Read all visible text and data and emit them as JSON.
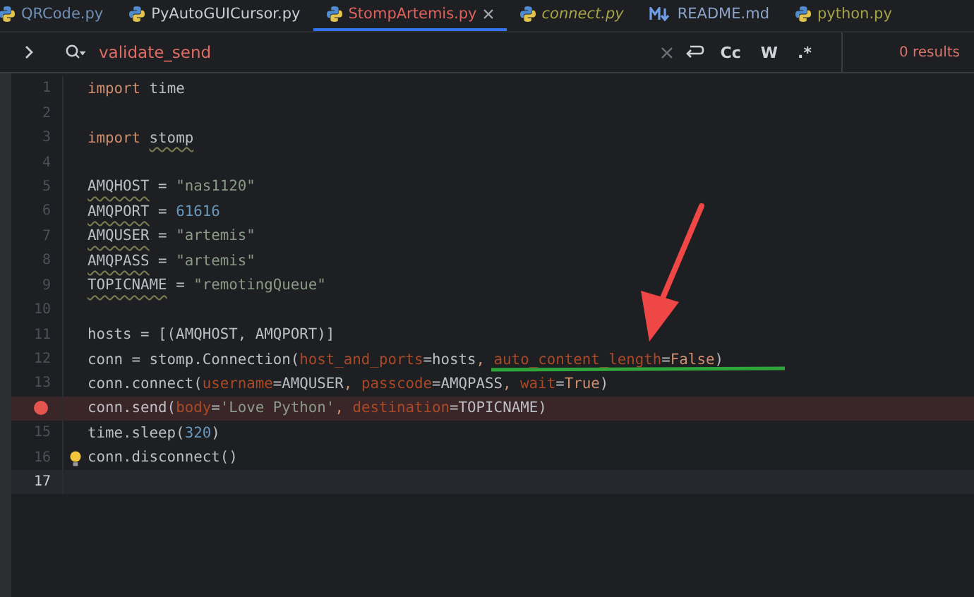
{
  "tabs": [
    {
      "label": "QRCode.py",
      "kind": "python",
      "color": "#6f8fb5",
      "italic": false,
      "selected": false,
      "closable": false
    },
    {
      "label": "PyAutoGUICursor.py",
      "kind": "python",
      "color": "#c9ccd3",
      "italic": false,
      "selected": false,
      "closable": false
    },
    {
      "label": "StompArtemis.py",
      "kind": "python",
      "color": "#e0625f",
      "italic": false,
      "selected": true,
      "closable": true
    },
    {
      "label": "connect.py",
      "kind": "python",
      "color": "#a6a24a",
      "italic": true,
      "selected": false,
      "closable": false
    },
    {
      "label": "README.md",
      "kind": "markdown",
      "color": "#8aa3c8",
      "italic": false,
      "selected": false,
      "closable": false
    },
    {
      "label": "python.py",
      "kind": "python",
      "color": "#a6a24a",
      "italic": false,
      "selected": false,
      "closable": false
    }
  ],
  "search": {
    "value": "validate_send",
    "options": [
      "Cc",
      "W",
      ".*"
    ],
    "results": "0 results"
  },
  "lines": [
    {
      "number": "1",
      "breakpoint": false,
      "current": false,
      "hint": false,
      "tokens": [
        {
          "kind": "keyword",
          "text": "import"
        },
        {
          "kind": "plain",
          "text": " time"
        }
      ]
    },
    {
      "number": "2",
      "breakpoint": false,
      "current": false,
      "hint": false
    },
    {
      "number": "3",
      "breakpoint": false,
      "current": false,
      "hint": false,
      "tokens": [
        {
          "kind": "keyword",
          "text": "import "
        },
        {
          "kind": "warn",
          "text": "stomp"
        }
      ]
    },
    {
      "number": "4",
      "breakpoint": false,
      "current": false,
      "hint": false
    },
    {
      "number": "5",
      "breakpoint": false,
      "current": false,
      "hint": false,
      "tokens": [
        {
          "kind": "warn",
          "text": "AMQHOST"
        },
        {
          "kind": "plain",
          "text": " = "
        },
        {
          "kind": "string",
          "text": "\"nas1120\""
        }
      ]
    },
    {
      "number": "6",
      "breakpoint": false,
      "current": false,
      "hint": false,
      "tokens": [
        {
          "kind": "warn",
          "text": "AMQPORT"
        },
        {
          "kind": "plain",
          "text": " = "
        },
        {
          "kind": "number",
          "text": "61616"
        }
      ]
    },
    {
      "number": "7",
      "breakpoint": false,
      "current": false,
      "hint": false,
      "tokens": [
        {
          "kind": "warn",
          "text": "AMQUSER"
        },
        {
          "kind": "plain",
          "text": " = "
        },
        {
          "kind": "string",
          "text": "\"artemis\""
        }
      ]
    },
    {
      "number": "8",
      "breakpoint": false,
      "current": false,
      "hint": false,
      "tokens": [
        {
          "kind": "warn",
          "text": "AMQPASS"
        },
        {
          "kind": "plain",
          "text": " = "
        },
        {
          "kind": "string",
          "text": "\"artemis\""
        }
      ]
    },
    {
      "number": "9",
      "breakpoint": false,
      "current": false,
      "hint": false,
      "tokens": [
        {
          "kind": "warn",
          "text": "TOPICNAME"
        },
        {
          "kind": "plain",
          "text": " = "
        },
        {
          "kind": "string",
          "text": "\"remotingQueue\""
        }
      ]
    },
    {
      "number": "10",
      "breakpoint": false,
      "current": false,
      "hint": false
    },
    {
      "number": "11",
      "breakpoint": false,
      "current": false,
      "hint": false,
      "tokens": [
        {
          "kind": "plain",
          "text": "hosts = [(AMQHOST, AMQPORT)]"
        }
      ]
    },
    {
      "number": "12",
      "breakpoint": false,
      "current": false,
      "hint": false,
      "tokens": [
        {
          "kind": "plain",
          "text": "conn = stomp.Connection("
        },
        {
          "kind": "param",
          "text": "host_and_ports"
        },
        {
          "kind": "plain",
          "text": "=hosts"
        },
        {
          "kind": "keyword",
          "text": ", "
        },
        {
          "kind": "param",
          "text": "auto_content_length"
        },
        {
          "kind": "plain",
          "text": "="
        },
        {
          "kind": "keyword",
          "text": "False"
        },
        {
          "kind": "plain",
          "text": ")"
        }
      ]
    },
    {
      "number": "13",
      "breakpoint": false,
      "current": false,
      "hint": false,
      "tokens": [
        {
          "kind": "plain",
          "text": "conn.connect("
        },
        {
          "kind": "param",
          "text": "username"
        },
        {
          "kind": "plain",
          "text": "=AMQUSER"
        },
        {
          "kind": "keyword",
          "text": ", "
        },
        {
          "kind": "param",
          "text": "passcode"
        },
        {
          "kind": "plain",
          "text": "=AMQPASS"
        },
        {
          "kind": "keyword",
          "text": ", "
        },
        {
          "kind": "param",
          "text": "wait"
        },
        {
          "kind": "plain",
          "text": "="
        },
        {
          "kind": "keyword",
          "text": "True"
        },
        {
          "kind": "plain",
          "text": ")"
        }
      ]
    },
    {
      "breakpoint": true,
      "current": false,
      "hint": false,
      "tokens": [
        {
          "kind": "plain",
          "text": "conn.send("
        },
        {
          "kind": "param",
          "text": "body"
        },
        {
          "kind": "plain",
          "text": "="
        },
        {
          "kind": "string",
          "text": "'Love Python'"
        },
        {
          "kind": "keyword",
          "text": ", "
        },
        {
          "kind": "param",
          "text": "destination"
        },
        {
          "kind": "plain",
          "text": "=TOPICNAME)"
        }
      ]
    },
    {
      "number": "15",
      "breakpoint": false,
      "current": false,
      "hint": false,
      "tokens": [
        {
          "kind": "plain",
          "text": "time.sleep("
        },
        {
          "kind": "number",
          "text": "320"
        },
        {
          "kind": "plain",
          "text": ")"
        }
      ]
    },
    {
      "number": "16",
      "breakpoint": false,
      "current": false,
      "hint": true,
      "tokens": [
        {
          "kind": "plain",
          "text": "conn.disconnect()"
        }
      ]
    },
    {
      "number": "17",
      "breakpoint": false,
      "current": true,
      "hint": false
    }
  ],
  "annotations": [
    {
      "kind": "arrow",
      "color": "#ef4646"
    },
    {
      "kind": "underline",
      "color": "#2ea43a"
    }
  ]
}
